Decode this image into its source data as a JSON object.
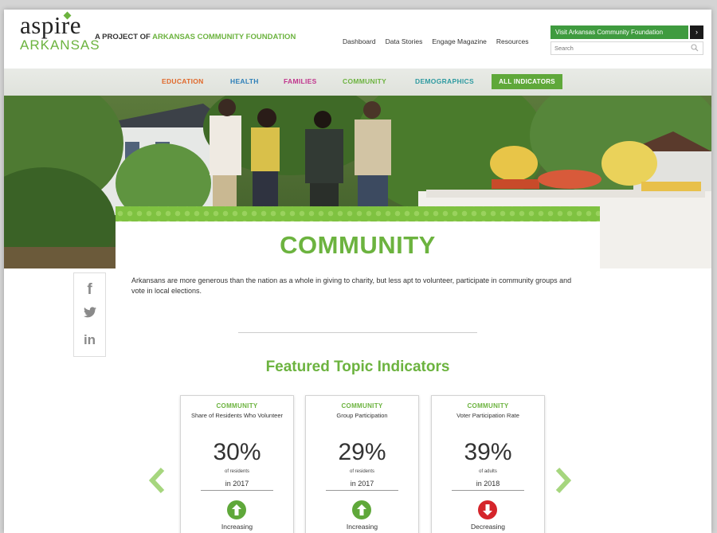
{
  "header": {
    "logo_main": "aspire",
    "logo_sub": "ARKANSAS",
    "project_prefix": "A PROJECT OF",
    "project_name": "ARKANSAS COMMUNITY FOUNDATION",
    "nav": [
      "Dashboard",
      "Data Stories",
      "Engage Magazine",
      "Resources"
    ],
    "visit_label": "Visit Arkansas Community Foundation",
    "visit_arrow": "›",
    "search_placeholder": "Search"
  },
  "categories": [
    {
      "label": "EDUCATION",
      "color": "#e0682a"
    },
    {
      "label": "HEALTH",
      "color": "#2d7fb8"
    },
    {
      "label": "FAMILIES",
      "color": "#c0358d"
    },
    {
      "label": "COMMUNITY",
      "color": "#6cb33f"
    },
    {
      "label": "DEMOGRAPHICS",
      "color": "#2e9aa0"
    }
  ],
  "all_indicators_label": "ALL INDICATORS",
  "page_title": "COMMUNITY",
  "description": "Arkansans are more generous than the nation as a whole in giving to charity, but less apt to volunteer, participate in community groups and vote in local elections.",
  "social": {
    "facebook": "f",
    "twitter": "twitter-bird",
    "linkedin": "in"
  },
  "featured_title": "Featured Topic Indicators",
  "cards": [
    {
      "category": "COMMUNITY",
      "name": "Share of Residents Who Volunteer",
      "value": "30%",
      "unit": "of residents",
      "year": "in 2017",
      "trend": "Increasing",
      "direction": "up"
    },
    {
      "category": "COMMUNITY",
      "name": "Group Participation",
      "value": "29%",
      "unit": "of residents",
      "year": "in 2017",
      "trend": "Increasing",
      "direction": "up"
    },
    {
      "category": "COMMUNITY",
      "name": "Voter Participation Rate",
      "value": "39%",
      "unit": "of adults",
      "year": "in 2018",
      "trend": "Decreasing",
      "direction": "down"
    }
  ],
  "colors": {
    "brand_green": "#6cb33f",
    "button_green": "#5fa83a",
    "increasing": "#5fa83a",
    "decreasing": "#d5252b"
  }
}
